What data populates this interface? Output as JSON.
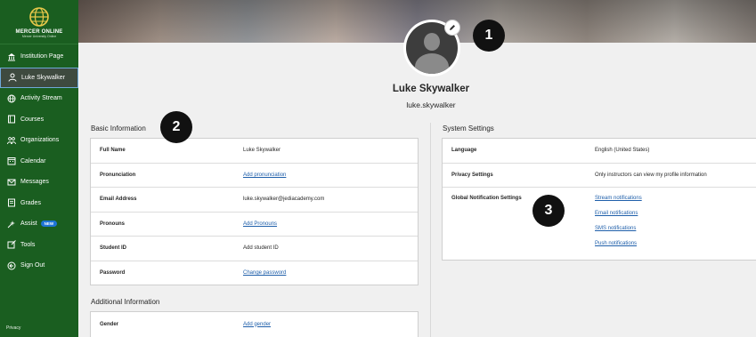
{
  "sidebar": {
    "logo_title": "MERCER ONLINE",
    "logo_sub": "Mercer University Online",
    "items": [
      {
        "label": "Institution Page",
        "icon": "institution-icon"
      },
      {
        "label": "Luke Skywalker",
        "icon": "user-icon"
      },
      {
        "label": "Activity Stream",
        "icon": "globe-icon"
      },
      {
        "label": "Courses",
        "icon": "book-icon"
      },
      {
        "label": "Organizations",
        "icon": "people-icon"
      },
      {
        "label": "Calendar",
        "icon": "calendar-icon"
      },
      {
        "label": "Messages",
        "icon": "envelope-icon"
      },
      {
        "label": "Grades",
        "icon": "grades-icon"
      },
      {
        "label": "Assist",
        "icon": "assist-icon",
        "badge": "NEW"
      },
      {
        "label": "Tools",
        "icon": "tools-icon"
      },
      {
        "label": "Sign Out",
        "icon": "signout-icon"
      }
    ],
    "privacy": "Privacy"
  },
  "profile": {
    "name": "Luke Skywalker",
    "username": "luke.skywalker"
  },
  "markers": [
    "1",
    "2",
    "3"
  ],
  "basic_info": {
    "title": "Basic Information",
    "rows": [
      {
        "label": "Full Name",
        "value": "Luke Skywalker",
        "link": false
      },
      {
        "label": "Pronunciation",
        "value": "Add pronunciation",
        "link": true
      },
      {
        "label": "Email Address",
        "value": "luke.skywalker@jediacademy.com",
        "link": false
      },
      {
        "label": "Pronouns",
        "value": "Add Pronouns",
        "link": true
      },
      {
        "label": "Student ID",
        "value": "Add student ID",
        "link": false
      },
      {
        "label": "Password",
        "value": "Change password",
        "link": true
      }
    ]
  },
  "additional_info": {
    "title": "Additional Information",
    "rows": [
      {
        "label": "Gender",
        "value": "Add gender",
        "link": true
      }
    ]
  },
  "system_settings": {
    "title": "System Settings",
    "language_label": "Language",
    "language_value": "English (United States)",
    "privacy_label": "Privacy Settings",
    "privacy_value": "Only instructors can view my profile information",
    "notif_label": "Global Notification Settings",
    "notif_links": [
      "Stream notifications",
      "Email notifications",
      "SMS notifications",
      "Push notifications"
    ]
  },
  "colors": {
    "sidebar": "#1a5e20",
    "link": "#1f5faa",
    "badge": "#1f74d6"
  }
}
